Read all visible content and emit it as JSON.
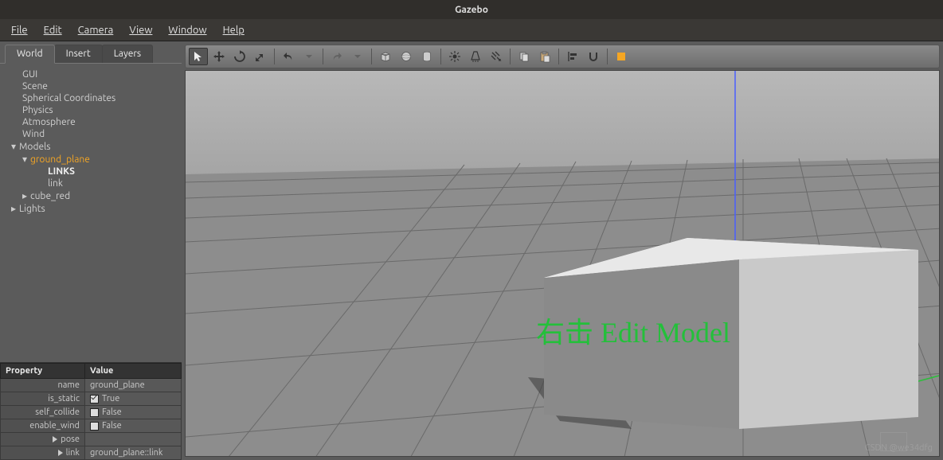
{
  "title": "Gazebo",
  "menu": {
    "file": "File",
    "edit": "Edit",
    "camera": "Camera",
    "view": "View",
    "window": "Window",
    "help": "Help"
  },
  "tabs": {
    "world": "World",
    "insert": "Insert",
    "layers": "Layers"
  },
  "tree": {
    "gui": "GUI",
    "scene": "Scene",
    "spherical": "Spherical Coordinates",
    "physics": "Physics",
    "atmosphere": "Atmosphere",
    "wind": "Wind",
    "models": "Models",
    "ground_plane": "ground_plane",
    "links_hdr": "LINKS",
    "link": "link",
    "cube_red": "cube_red",
    "lights": "Lights"
  },
  "props": {
    "header_prop": "Property",
    "header_val": "Value",
    "rows": {
      "name": {
        "k": "name",
        "v": "ground_plane"
      },
      "is_static": {
        "k": "is_static",
        "v": "True"
      },
      "self_collide": {
        "k": "self_collide",
        "v": "False"
      },
      "enable_wind": {
        "k": "enable_wind",
        "v": "False"
      },
      "pose": {
        "k": "pose",
        "v": ""
      },
      "link": {
        "k": "link",
        "v": "ground_plane::link"
      }
    }
  },
  "annotation": "右击 Edit Model",
  "watermark": "CSDN @we34dfg",
  "toolbar_icons": {
    "select": "select-arrow",
    "move": "move",
    "rotate": "rotate",
    "scale": "scale",
    "undo": "undo",
    "redo": "redo",
    "box": "box",
    "sphere": "sphere",
    "cylinder": "cylinder",
    "light_point": "light-point",
    "light_spot": "light-spot",
    "light_dir": "light-directional",
    "copy": "copy",
    "paste": "paste",
    "align": "align",
    "snap": "snap",
    "orange": "view-angle"
  }
}
